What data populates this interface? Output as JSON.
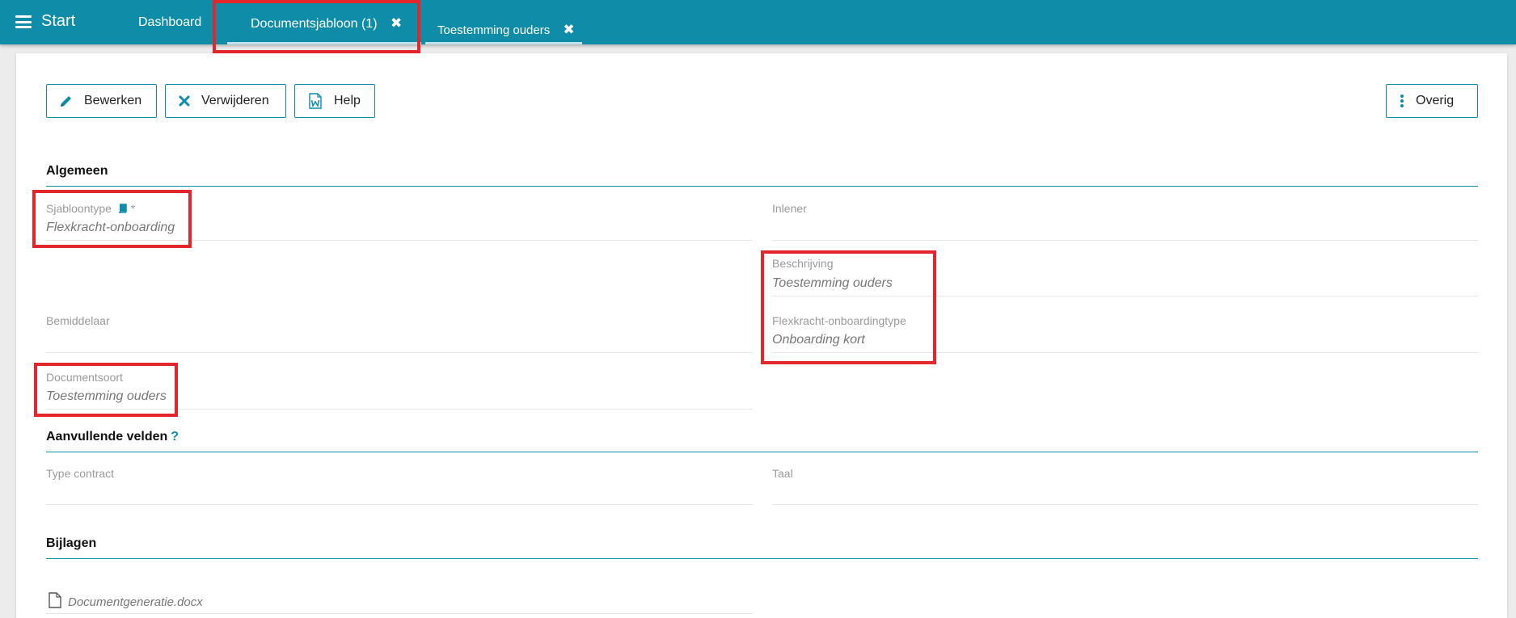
{
  "topbar": {
    "start_label": "Start",
    "tabs": [
      {
        "label": "Dashboard"
      },
      {
        "label": "Documentsjabloon (1)",
        "close": "✖"
      },
      {
        "label": "Toestemming ouders",
        "close": "✖"
      }
    ]
  },
  "toolbar": {
    "edit_label": "Bewerken",
    "delete_label": "Verwijderen",
    "help_label": "Help",
    "more_label": "Overig"
  },
  "sections": {
    "general": {
      "title": "Algemeen",
      "sjabloontype_label": "Sjabloontype",
      "sjabloontype_required": "*",
      "sjabloontype_value": "Flexkracht-onboarding",
      "inlener_label": "Inlener",
      "beschrijving_label": "Beschrijving",
      "beschrijving_value": "Toestemming ouders",
      "bemiddelaar_label": "Bemiddelaar",
      "onboardingtype_label": "Flexkracht-onboardingtype",
      "onboardingtype_value": "Onboarding kort",
      "documentsoort_label": "Documentsoort",
      "documentsoort_value": "Toestemming ouders"
    },
    "extra": {
      "title": "Aanvullende velden",
      "help": "?",
      "type_contract_label": "Type contract",
      "taal_label": "Taal"
    },
    "attachments": {
      "title": "Bijlagen",
      "file_name": "Documentgeneratie.docx"
    }
  },
  "colors": {
    "accent": "#0f8ca8",
    "highlight": "#e3262b"
  }
}
